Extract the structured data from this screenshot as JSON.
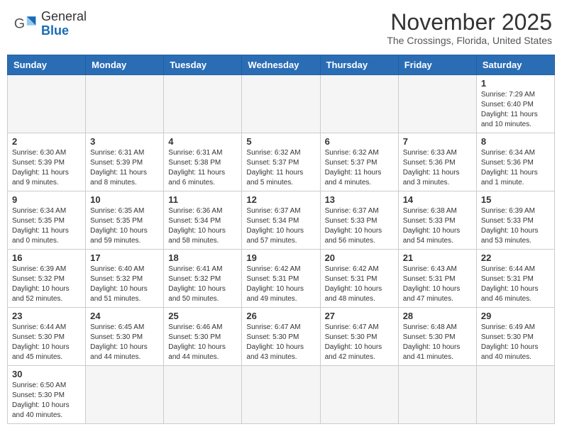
{
  "header": {
    "logo_general": "General",
    "logo_blue": "Blue",
    "month_title": "November 2025",
    "location": "The Crossings, Florida, United States"
  },
  "days_of_week": [
    "Sunday",
    "Monday",
    "Tuesday",
    "Wednesday",
    "Thursday",
    "Friday",
    "Saturday"
  ],
  "weeks": [
    [
      {
        "day": null,
        "info": null
      },
      {
        "day": null,
        "info": null
      },
      {
        "day": null,
        "info": null
      },
      {
        "day": null,
        "info": null
      },
      {
        "day": null,
        "info": null
      },
      {
        "day": null,
        "info": null
      },
      {
        "day": "1",
        "info": "Sunrise: 7:29 AM\nSunset: 6:40 PM\nDaylight: 11 hours\nand 10 minutes."
      }
    ],
    [
      {
        "day": "2",
        "info": "Sunrise: 6:30 AM\nSunset: 5:39 PM\nDaylight: 11 hours\nand 9 minutes."
      },
      {
        "day": "3",
        "info": "Sunrise: 6:31 AM\nSunset: 5:39 PM\nDaylight: 11 hours\nand 8 minutes."
      },
      {
        "day": "4",
        "info": "Sunrise: 6:31 AM\nSunset: 5:38 PM\nDaylight: 11 hours\nand 6 minutes."
      },
      {
        "day": "5",
        "info": "Sunrise: 6:32 AM\nSunset: 5:37 PM\nDaylight: 11 hours\nand 5 minutes."
      },
      {
        "day": "6",
        "info": "Sunrise: 6:32 AM\nSunset: 5:37 PM\nDaylight: 11 hours\nand 4 minutes."
      },
      {
        "day": "7",
        "info": "Sunrise: 6:33 AM\nSunset: 5:36 PM\nDaylight: 11 hours\nand 3 minutes."
      },
      {
        "day": "8",
        "info": "Sunrise: 6:34 AM\nSunset: 5:36 PM\nDaylight: 11 hours\nand 1 minute."
      }
    ],
    [
      {
        "day": "9",
        "info": "Sunrise: 6:34 AM\nSunset: 5:35 PM\nDaylight: 11 hours\nand 0 minutes."
      },
      {
        "day": "10",
        "info": "Sunrise: 6:35 AM\nSunset: 5:35 PM\nDaylight: 10 hours\nand 59 minutes."
      },
      {
        "day": "11",
        "info": "Sunrise: 6:36 AM\nSunset: 5:34 PM\nDaylight: 10 hours\nand 58 minutes."
      },
      {
        "day": "12",
        "info": "Sunrise: 6:37 AM\nSunset: 5:34 PM\nDaylight: 10 hours\nand 57 minutes."
      },
      {
        "day": "13",
        "info": "Sunrise: 6:37 AM\nSunset: 5:33 PM\nDaylight: 10 hours\nand 56 minutes."
      },
      {
        "day": "14",
        "info": "Sunrise: 6:38 AM\nSunset: 5:33 PM\nDaylight: 10 hours\nand 54 minutes."
      },
      {
        "day": "15",
        "info": "Sunrise: 6:39 AM\nSunset: 5:33 PM\nDaylight: 10 hours\nand 53 minutes."
      }
    ],
    [
      {
        "day": "16",
        "info": "Sunrise: 6:39 AM\nSunset: 5:32 PM\nDaylight: 10 hours\nand 52 minutes."
      },
      {
        "day": "17",
        "info": "Sunrise: 6:40 AM\nSunset: 5:32 PM\nDaylight: 10 hours\nand 51 minutes."
      },
      {
        "day": "18",
        "info": "Sunrise: 6:41 AM\nSunset: 5:32 PM\nDaylight: 10 hours\nand 50 minutes."
      },
      {
        "day": "19",
        "info": "Sunrise: 6:42 AM\nSunset: 5:31 PM\nDaylight: 10 hours\nand 49 minutes."
      },
      {
        "day": "20",
        "info": "Sunrise: 6:42 AM\nSunset: 5:31 PM\nDaylight: 10 hours\nand 48 minutes."
      },
      {
        "day": "21",
        "info": "Sunrise: 6:43 AM\nSunset: 5:31 PM\nDaylight: 10 hours\nand 47 minutes."
      },
      {
        "day": "22",
        "info": "Sunrise: 6:44 AM\nSunset: 5:31 PM\nDaylight: 10 hours\nand 46 minutes."
      }
    ],
    [
      {
        "day": "23",
        "info": "Sunrise: 6:44 AM\nSunset: 5:30 PM\nDaylight: 10 hours\nand 45 minutes."
      },
      {
        "day": "24",
        "info": "Sunrise: 6:45 AM\nSunset: 5:30 PM\nDaylight: 10 hours\nand 44 minutes."
      },
      {
        "day": "25",
        "info": "Sunrise: 6:46 AM\nSunset: 5:30 PM\nDaylight: 10 hours\nand 44 minutes."
      },
      {
        "day": "26",
        "info": "Sunrise: 6:47 AM\nSunset: 5:30 PM\nDaylight: 10 hours\nand 43 minutes."
      },
      {
        "day": "27",
        "info": "Sunrise: 6:47 AM\nSunset: 5:30 PM\nDaylight: 10 hours\nand 42 minutes."
      },
      {
        "day": "28",
        "info": "Sunrise: 6:48 AM\nSunset: 5:30 PM\nDaylight: 10 hours\nand 41 minutes."
      },
      {
        "day": "29",
        "info": "Sunrise: 6:49 AM\nSunset: 5:30 PM\nDaylight: 10 hours\nand 40 minutes."
      }
    ],
    [
      {
        "day": "30",
        "info": "Sunrise: 6:50 AM\nSunset: 5:30 PM\nDaylight: 10 hours\nand 40 minutes."
      },
      {
        "day": null,
        "info": null
      },
      {
        "day": null,
        "info": null
      },
      {
        "day": null,
        "info": null
      },
      {
        "day": null,
        "info": null
      },
      {
        "day": null,
        "info": null
      },
      {
        "day": null,
        "info": null
      }
    ]
  ]
}
